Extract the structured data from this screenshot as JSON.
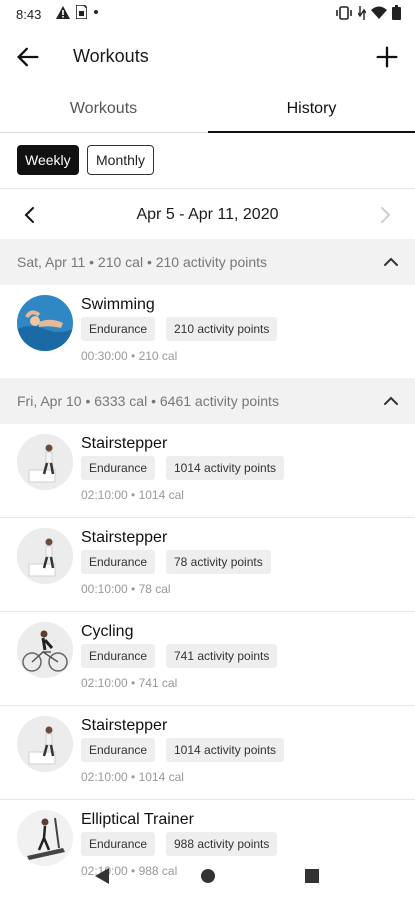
{
  "status_bar": {
    "time": "8:43",
    "left_icons": [
      "warning-icon",
      "sim-icon",
      "dot-icon"
    ],
    "right_icons": [
      "vibrate-icon",
      "data-icon",
      "wifi-icon",
      "battery-icon"
    ]
  },
  "appbar": {
    "title": "Workouts"
  },
  "tabs": [
    {
      "label": "Workouts",
      "selected": false
    },
    {
      "label": "History",
      "selected": true
    }
  ],
  "period": {
    "weekly": "Weekly",
    "monthly": "Monthly",
    "selected": "Weekly"
  },
  "range": {
    "label": "Apr 5 - Apr 11, 2020"
  },
  "days": [
    {
      "header": "Sat, Apr 11 • 210 cal • 210 activity points",
      "items": [
        {
          "name": "Swimming",
          "category": "Endurance",
          "points": "210 activity points",
          "meta": "00:30:00 • 210 cal",
          "icon": "swimming-icon"
        }
      ]
    },
    {
      "header": "Fri, Apr 10 • 6333 cal • 6461 activity points",
      "items": [
        {
          "name": "Stairstepper",
          "category": "Endurance",
          "points": "1014 activity points",
          "meta": "02:10:00 • 1014 cal",
          "icon": "stairstepper-icon"
        },
        {
          "name": "Stairstepper",
          "category": "Endurance",
          "points": "78 activity points",
          "meta": "00:10:00 • 78 cal",
          "icon": "stairstepper-icon"
        },
        {
          "name": "Cycling",
          "category": "Endurance",
          "points": "741 activity points",
          "meta": "02:10:00 • 741 cal",
          "icon": "cycling-icon"
        },
        {
          "name": "Stairstepper",
          "category": "Endurance",
          "points": "1014 activity points",
          "meta": "02:10:00 • 1014 cal",
          "icon": "stairstepper-icon"
        },
        {
          "name": "Elliptical Trainer",
          "category": "Endurance",
          "points": "988 activity points",
          "meta": "02:10:00 • 988 cal",
          "icon": "elliptical-icon"
        }
      ]
    }
  ]
}
